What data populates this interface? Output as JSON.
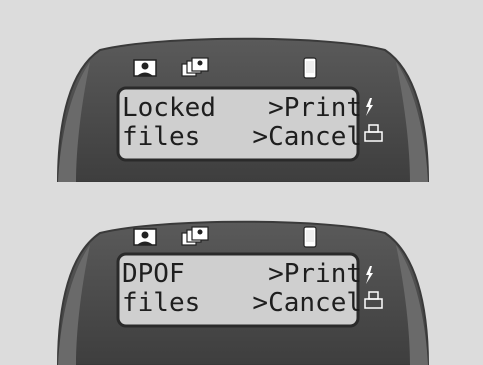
{
  "screens": [
    {
      "lines": [
        {
          "left": "Locked",
          "right": ">Print"
        },
        {
          "left": "files",
          "right": ">Cancel"
        }
      ]
    },
    {
      "lines": [
        {
          "left": "DPOF",
          "right": ">Print"
        },
        {
          "left": "files",
          "right": ">Cancel"
        }
      ]
    }
  ],
  "colors": {
    "background": "#dcdcdc",
    "bezel": "#4d4d4d",
    "bezel_edge": "#3a3a3a",
    "lcd": "#cfcfcf",
    "lcd_border": "#2a2a2a",
    "text": "#1e1e1e"
  },
  "icons": [
    "photo-icon",
    "multi-photo-icon",
    "phone-icon",
    "flash-icon",
    "printer-icon"
  ]
}
